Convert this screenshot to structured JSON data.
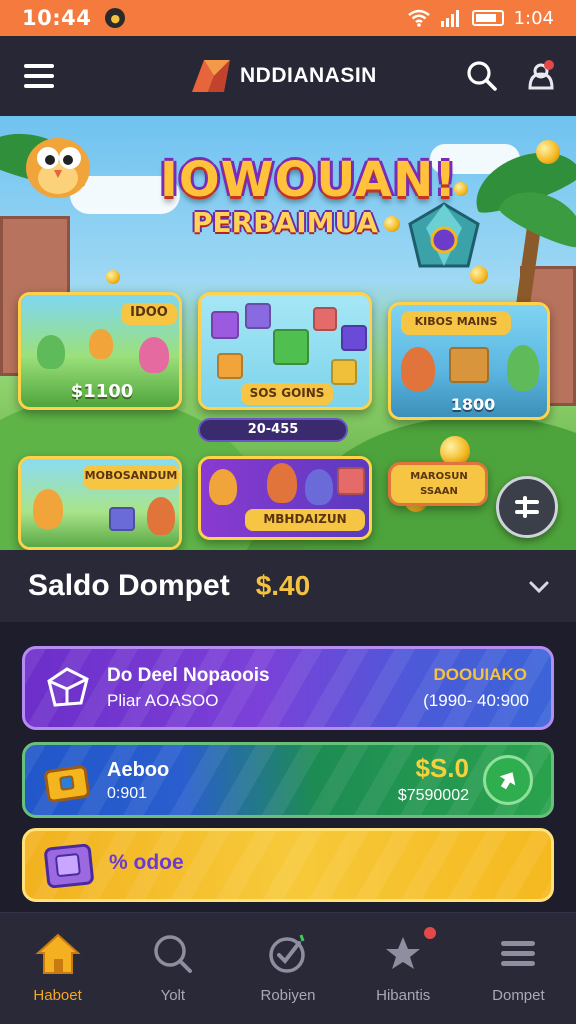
{
  "status_bar": {
    "time": "10:44",
    "right_text": "1:04"
  },
  "header": {
    "brand_name": "NDDIANASIN"
  },
  "banner": {
    "title_line1": "IOWOUAN!",
    "title_line2": "PERBAIMUA",
    "cards": [
      {
        "top_tag": "IDOO",
        "bottom_tag": "$1100"
      },
      {
        "bottom_tag": "SOS GOINS"
      },
      {
        "top_tag": "KIBOS MAINS",
        "bottom_tag": "1800"
      },
      {
        "top_tag": "MOBOSANDUM"
      },
      {
        "tag": "MBHDAIZUN"
      },
      {
        "tag": "MAROSUN SSAAN"
      }
    ],
    "slide_label": "20-455"
  },
  "wallet": {
    "title": "Saldo Dompet",
    "amount": "$.40"
  },
  "rows": [
    {
      "title": "Do Deel Nopaoois",
      "subtitle": "Pliar AOASOO",
      "right_title": "DOOUIAKO",
      "right_value": "(1990- 40:900"
    },
    {
      "title": "Aeboo",
      "subtitle": "0:901",
      "right_title": "$S.0",
      "right_value": "$7590002"
    },
    {
      "title": "% odoe"
    }
  ],
  "nav": [
    {
      "label": "Haboet",
      "icon": "home-icon"
    },
    {
      "label": "Yolt",
      "icon": "search-icon"
    },
    {
      "label": "Robiyen",
      "icon": "check-badge-icon"
    },
    {
      "label": "Hibantis",
      "icon": "star-person-icon"
    },
    {
      "label": "Dompet",
      "icon": "wallet-lines-icon"
    }
  ],
  "colors": {
    "status_bar": "#f47a3d",
    "accent_gold": "#f5c23d",
    "active_nav": "#f5a623",
    "background": "#1e1d2b"
  }
}
